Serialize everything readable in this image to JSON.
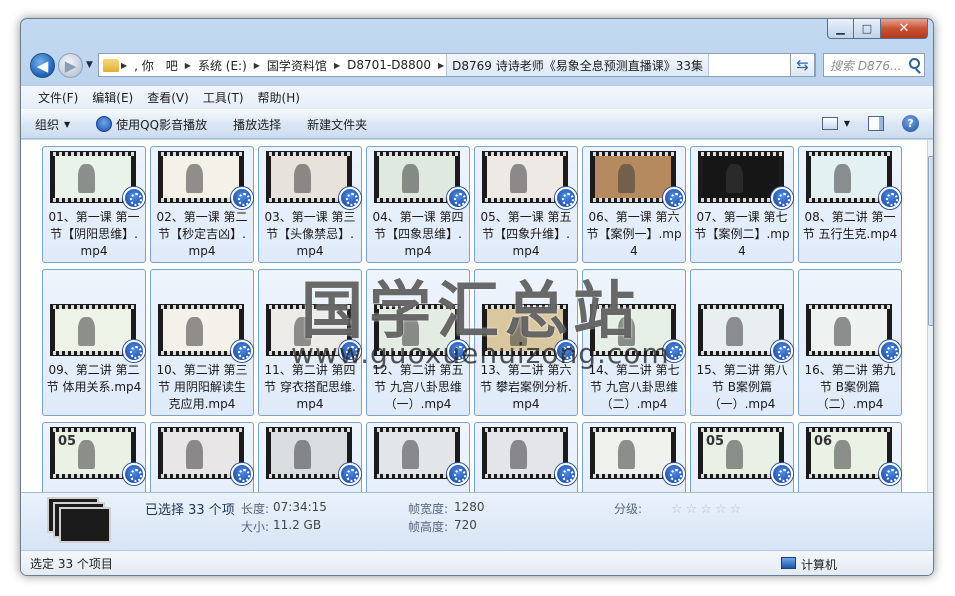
{
  "window": {
    "controls": {
      "minimize": "▁",
      "maximize": "□",
      "close": "✕"
    }
  },
  "navigation": {
    "breadcrumbs": [
      ", 你　吧",
      "系统 (E:)",
      "国学资料馆",
      "D8701-D8800"
    ],
    "current": "D8769 诗诗老师《易象全息预测直播课》33集",
    "search_placeholder": "搜索 D876..."
  },
  "menu": [
    "文件(F)",
    "编辑(E)",
    "查看(V)",
    "工具(T)",
    "帮助(H)"
  ],
  "commands": {
    "organize": "组织",
    "play_qq": "使用QQ影音播放",
    "play_selection": "播放选择",
    "new_folder": "新建文件夹"
  },
  "files": [
    {
      "name": "01、第一课 第一节【阴阳思维】.mp4"
    },
    {
      "name": "02、第一课 第二节【秒定吉凶】.mp4"
    },
    {
      "name": "03、第一课 第三节【头像禁忌】.mp4"
    },
    {
      "name": "04、第一课 第四节【四象思维】.mp4"
    },
    {
      "name": "05、第一课 第五节【四象升维】.mp4"
    },
    {
      "name": "06、第一课 第六节【案例一】.mp4"
    },
    {
      "name": "07、第一课 第七节【案例二】.mp4"
    },
    {
      "name": "08、第二讲 第一节 五行生克.mp4"
    },
    {
      "name": "09、第二讲 第二节 体用关系.mp4"
    },
    {
      "name": "10、第二讲 第三节 用阴阳解读生克应用.mp4"
    },
    {
      "name": "11、第二讲 第四节 穿衣搭配思维.mp4"
    },
    {
      "name": "12、第二讲 第五节 九宫八卦思维（一）.mp4"
    },
    {
      "name": "13、第二讲 第六节 攀岩案例分析.mp4"
    },
    {
      "name": "14、第二讲 第七节 九宫八卦思维（二）.mp4"
    },
    {
      "name": "15、第二讲 第八节 B案例篇（一）.mp4"
    },
    {
      "name": "16、第二讲 第九节 B案例篇（二）.mp4"
    },
    {
      "name": ""
    },
    {
      "name": ""
    },
    {
      "name": ""
    },
    {
      "name": ""
    },
    {
      "name": ""
    },
    {
      "name": ""
    },
    {
      "name": ""
    },
    {
      "name": ""
    }
  ],
  "thumb_colors": [
    "#e9f3ea",
    "#f4f1e8",
    "#e8e2dc",
    "#dfe9df",
    "#eee9e4",
    "#b58a5e",
    "#161616",
    "#e4f1f2",
    "#eef3e8",
    "#f3f1ea",
    "#ecebe8",
    "#e3ece2",
    "#d9c7a0",
    "#e6efe6",
    "#e9eef0",
    "#eef2f1",
    "#eaf2e6",
    "#e8e6e6",
    "#d9dde0",
    "#e2e6e8",
    "#e4e5e8",
    "#eef1ec",
    "#e9f1e6",
    "#eaf2e6"
  ],
  "thumb_numbers": [
    "05",
    "06"
  ],
  "watermark": {
    "cn": "国学汇总站",
    "url": "www.guoxuehuizong.com"
  },
  "details": {
    "selected": "已选择 33 个项",
    "length_label": "长度:",
    "length": "07:34:15",
    "size_label": "大小:",
    "size": "11.2 GB",
    "frame_width_label": "帧宽度:",
    "frame_width": "1280",
    "frame_height_label": "帧高度:",
    "frame_height": "720",
    "rating_label": "分级:",
    "rating_stars": "☆☆☆☆☆"
  },
  "status": {
    "left": "选定 33 个项目",
    "right": "计算机"
  }
}
